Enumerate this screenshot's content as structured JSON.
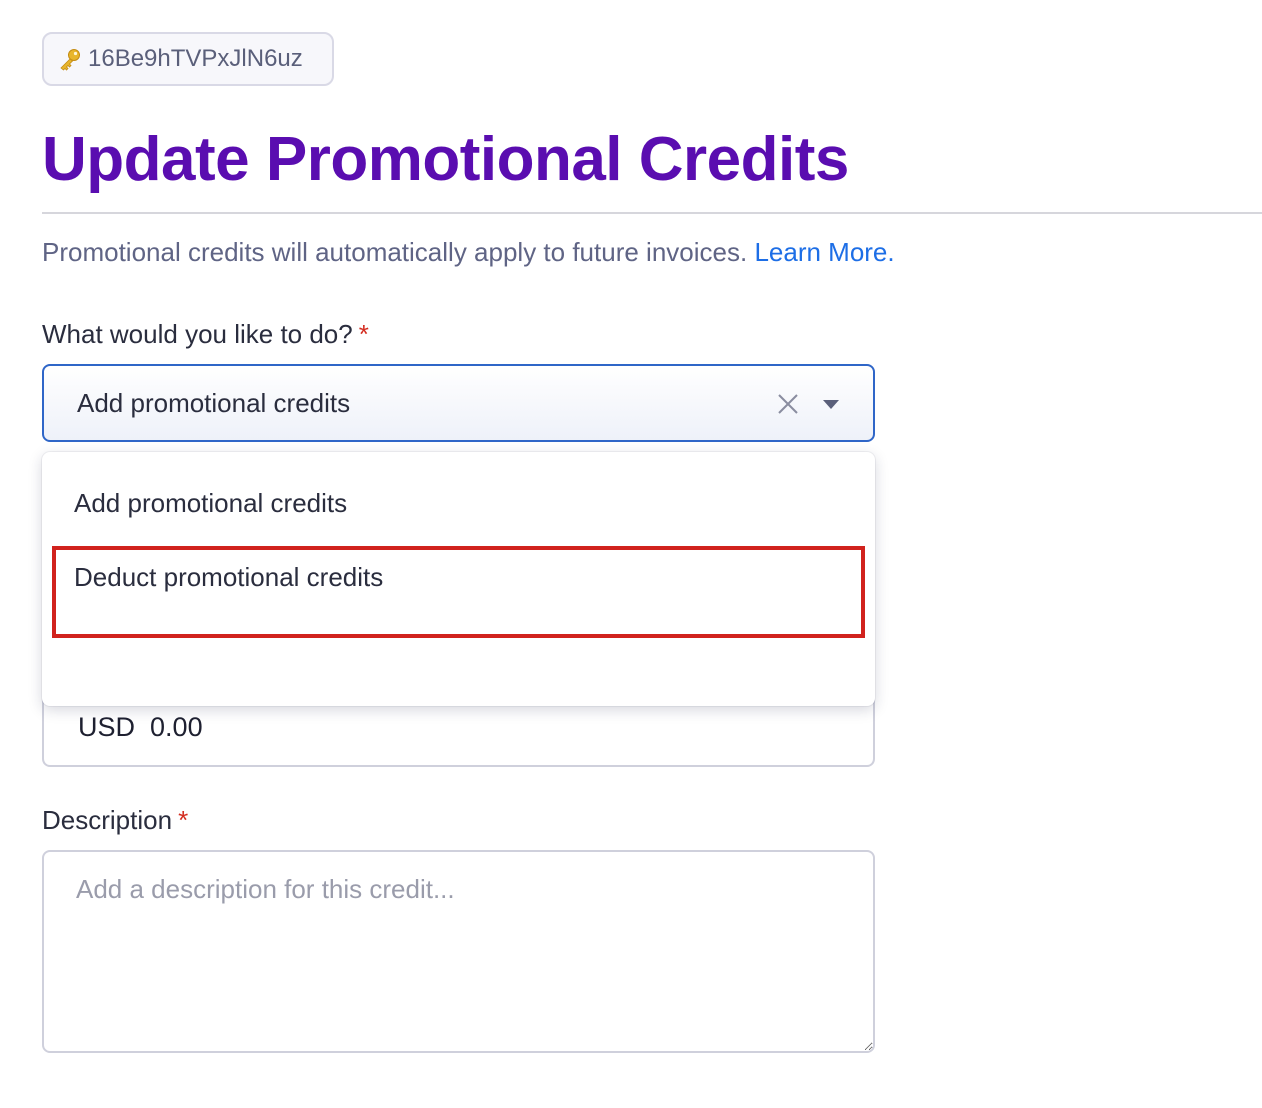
{
  "id_pill": {
    "icon": "key-icon",
    "text": "16Be9hTVPxJlN6uz"
  },
  "page": {
    "title": "Update Promotional Credits",
    "subtitle": "Promotional credits will automatically apply to future invoices.",
    "learn_more": "Learn More."
  },
  "action_field": {
    "label": "What would you like to do?",
    "required_mark": "*",
    "selected_value": "Add promotional credits",
    "options": [
      "Add promotional credits",
      "Deduct promotional credits"
    ]
  },
  "amount_field": {
    "currency": "USD",
    "value": "0.00"
  },
  "description_field": {
    "label": "Description",
    "required_mark": "*",
    "placeholder": "Add a description for this credit..."
  },
  "colors": {
    "title": "#5a0db0",
    "link": "#1d6ee6",
    "required": "#d42d20",
    "focus_border": "#2f66c8",
    "highlight": "#d1221d"
  }
}
